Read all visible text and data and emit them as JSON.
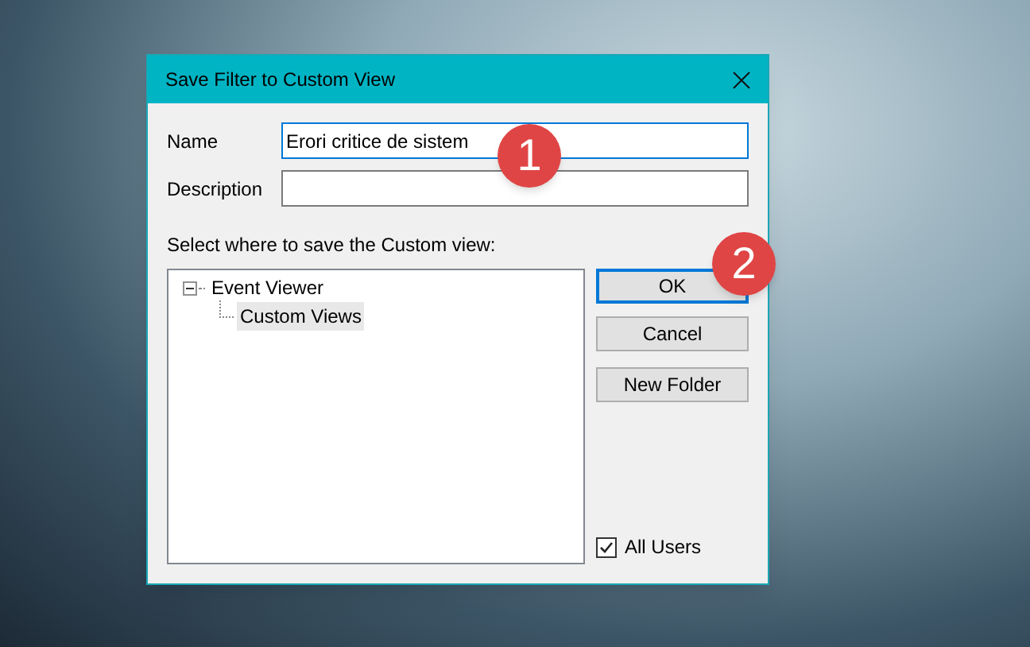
{
  "window": {
    "title": "Save Filter to Custom View"
  },
  "fields": [
    {
      "label": "Name",
      "value": "Erori critice de sistem",
      "focused": true
    },
    {
      "label": "Description",
      "focused": false
    }
  ],
  "tree_label": "Select where to save the Custom view:",
  "tree": [
    {
      "label": "Event Viewer",
      "expanded": true,
      "selected": false,
      "children": [
        {
          "label": "Custom Views",
          "selected": true
        }
      ]
    }
  ],
  "buttons": [
    {
      "label": "OK",
      "default": true
    },
    {
      "label": "Cancel",
      "default": false
    },
    {
      "label": "New Folder",
      "default": false
    }
  ],
  "all_users": {
    "label": "All Users",
    "checked": true
  },
  "callouts": [
    "1",
    "2"
  ]
}
